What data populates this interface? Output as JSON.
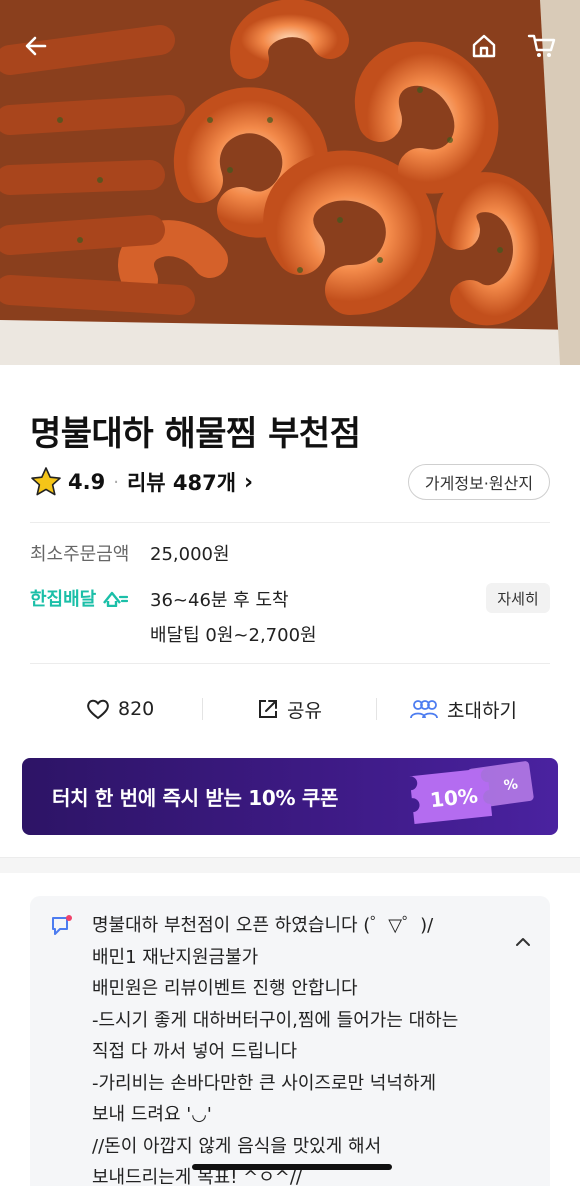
{
  "store": {
    "name": "명불대하 해물찜 부천점",
    "rating": "4.9",
    "review_label": "리뷰 487개",
    "info_button": "가게정보·원산지"
  },
  "order": {
    "min_order_label": "최소주문금액",
    "min_order_value": "25,000원"
  },
  "delivery": {
    "brand": "한집배달",
    "eta": "36~46분 후 도착",
    "tip": "배달팁 0원~2,700원",
    "detail_button": "자세히"
  },
  "actions": {
    "like_count": "820",
    "share_label": "공유",
    "invite_label": "초대하기"
  },
  "coupon": {
    "text": "터치 한 번에 즉시 받는 10% 쿠폰",
    "badge": "10%",
    "badge_small": "%"
  },
  "notice": {
    "lines": [
      "명불대하 부천점이 오픈 하였습니다 (゜▽゜)/",
      "배민1 재난지원금불가",
      "배민원은 리뷰이벤트 진행 안합니다",
      "-드시기 좋게 대하버터구이,찜에 들어가는 대하는",
      "직접 다 까서 넣어 드립니다",
      "-가리비는 손바다만한 큰 사이즈로만 넉넉하게",
      "보내 드려요 '◡'",
      "//돈이 아깝지 않게 음식을 맛있게 해서",
      "보내드리는게 목표! ^ㅇ^//"
    ]
  },
  "icons": {
    "back": "back-arrow-icon",
    "home": "home-icon",
    "cart": "cart-icon",
    "star": "star-icon",
    "heart": "heart-icon",
    "share": "share-icon",
    "invite": "people-icon",
    "notice": "notice-icon",
    "collapse": "chevron-up-icon"
  },
  "colors": {
    "accent_mint": "#1bbfa8",
    "coupon_bg": "#3d1a84",
    "coupon_badge": "#b46cf0",
    "invite_blue": "#4c7cf0",
    "star": "#f5c518"
  }
}
